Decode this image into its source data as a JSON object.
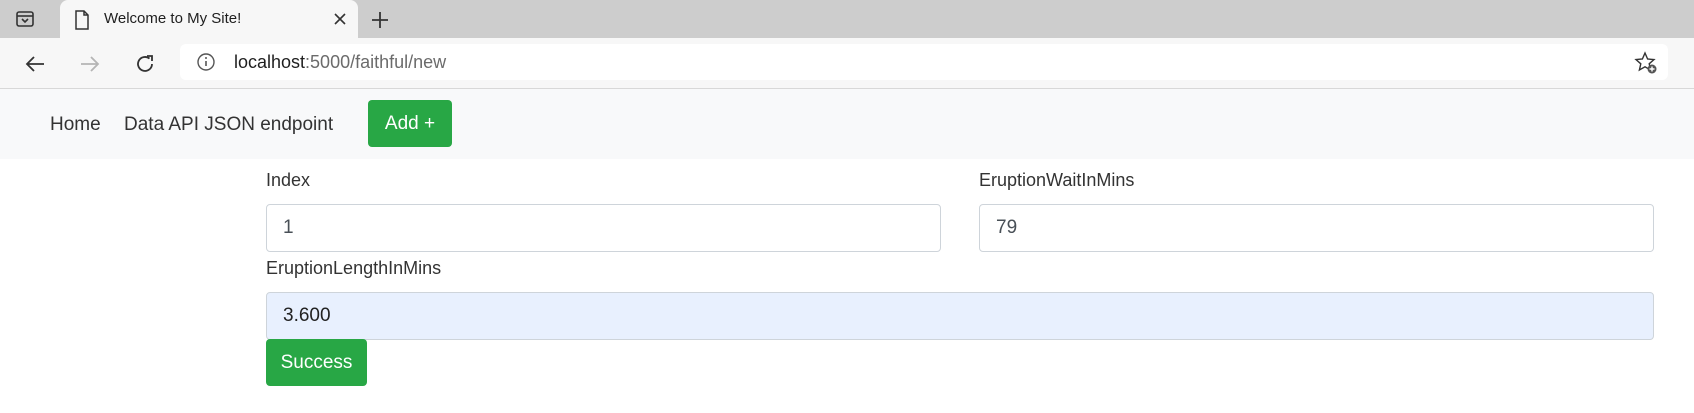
{
  "browser": {
    "tab_title": "Welcome to My Site!",
    "url_host": "localhost",
    "url_rest": ":5000/faithful/new"
  },
  "nav": {
    "home": "Home",
    "api": "Data API JSON endpoint",
    "add": "Add +"
  },
  "form": {
    "index_label": "Index",
    "index_value": "1",
    "wait_label": "EruptionWaitInMins",
    "wait_value": "79",
    "length_label": "EruptionLengthInMins",
    "length_value": "3.600",
    "submit": "Success"
  },
  "colors": {
    "success": "#28a745",
    "autofill": "#e8f0fe"
  }
}
